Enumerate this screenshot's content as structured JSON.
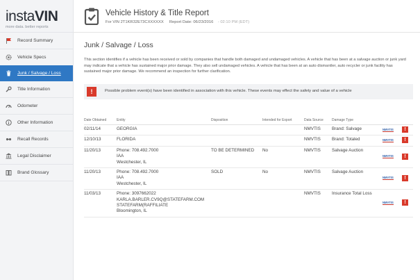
{
  "brand": {
    "logo_part1": "insta",
    "logo_part2": "VIN",
    "tagline": "more data. better reports"
  },
  "sidebar": {
    "items": [
      {
        "label": "Record Summary",
        "icon": "flag-icon"
      },
      {
        "label": "Vehicle Specs",
        "icon": "gear-icon"
      },
      {
        "label": "Junk / Salvage / Loss",
        "icon": "trash-icon"
      },
      {
        "label": "Title Information",
        "icon": "wrench-icon"
      },
      {
        "label": "Odometer",
        "icon": "odometer-icon"
      },
      {
        "label": "Other Information",
        "icon": "info-icon"
      },
      {
        "label": "Recall Records",
        "icon": "recall-icon"
      },
      {
        "label": "Legal Disclaimer",
        "icon": "bank-icon"
      },
      {
        "label": "Brand Glossary",
        "icon": "book-icon"
      }
    ],
    "active_index": 2
  },
  "header": {
    "title": "Vehicle History & Title Report",
    "vin_text": "For VIN 2T1KR32E73CXXXXXX",
    "report_date_text": "Report Date: 06/23/2016",
    "time_text": "- 02:10 PM (EDT)"
  },
  "section": {
    "title": "Junk / Salvage / Loss",
    "description": "This section identifies if a vehicle has been received or sold by companies that handle both damaged and undamaged vehicles. A vehicle that has been at a salvage auction or junk yard may indicate that a vehicle has sustained major prior damage. They also sell undamaged vehicles. A vehicle that has been at an auto dismantler, auto recycler or junk facility has sustained major prior damage. We recommend an inspection for further clarification."
  },
  "alert": {
    "icon_text": "!",
    "text": "Possible problem event(s) have been identified in association with this vehicle. These events may effect the safety and value of a vehicle"
  },
  "table": {
    "headers": [
      "Date Obtained",
      "Entity",
      "Disposition",
      "Intended for Export",
      "Data Source",
      "Damage Type"
    ],
    "rows": [
      {
        "date": "02/11/14",
        "entity": [
          "GEORGIA"
        ],
        "disposition": "",
        "export": "",
        "source": "NMVTIS",
        "damage": "Brand: Salvage"
      },
      {
        "date": "12/10/13",
        "entity": [
          "FLORIDA"
        ],
        "disposition": "",
        "export": "",
        "source": "NMVTIS",
        "damage": "Brand: Totaled"
      },
      {
        "date": "11/20/13",
        "entity": [
          "Phone: 708.492.7000",
          "IAA",
          "Westchester, IL"
        ],
        "disposition": "TO BE DETERMINED",
        "export": "No",
        "source": "NMVTIS",
        "damage": "Salvage Auction"
      },
      {
        "date": "11/20/13",
        "entity": [
          "Phone: 708.492.7000",
          "IAA",
          "Westchester, IL"
        ],
        "disposition": "SOLD",
        "export": "No",
        "source": "NMVTIS",
        "damage": "Salvage Auction"
      },
      {
        "date": "11/03/13",
        "entity": [
          "Phone: 3097662022",
          "KARLA.BARLER.CV9Q@STATEFARM.COM",
          "STATEFARM(RAFFILIATE",
          "Bloomington, IL"
        ],
        "disposition": "",
        "export": "",
        "source": "NMVTIS",
        "damage": "Insurance Total Loss"
      }
    ],
    "source_logo_text": "NMVTIS",
    "flag_text": "!"
  },
  "colors": {
    "accent": "#2f78c4",
    "alert_red": "#d93a2b",
    "sidebar_bg": "#f3f4f6"
  }
}
